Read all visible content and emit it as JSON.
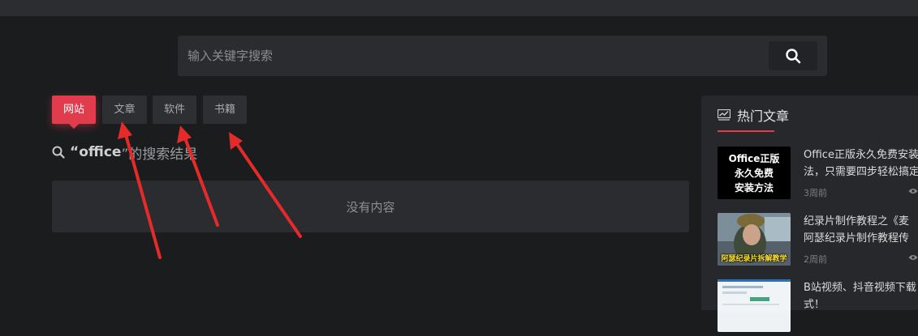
{
  "search": {
    "placeholder": "输入关键字搜索",
    "value": ""
  },
  "tabs": [
    {
      "label": "网站",
      "active": true
    },
    {
      "label": "文章",
      "active": false
    },
    {
      "label": "软件",
      "active": false
    },
    {
      "label": "书籍",
      "active": false
    }
  ],
  "results": {
    "prefix": "“",
    "query": "office",
    "suffix": "”的搜索结果",
    "empty_text": "没有内容"
  },
  "sidebar": {
    "title": "热门文章",
    "posts": [
      {
        "title_line1": "Office正版永久免费安装",
        "title_line2": "法，只需要四步轻松搞定",
        "time": "3周前",
        "thumb_lines": [
          "Office正版",
          "永久免费",
          "安装方法"
        ]
      },
      {
        "title_line1": "纪录片制作教程之《麦",
        "title_line2": "阿瑟纪录片制作教程传",
        "time": "2周前",
        "thumb_caption": "阿瑟纪录片拆解教学"
      },
      {
        "title_line1": "B站视频、抖音视频下载",
        "title_line2": "式！",
        "time": ""
      }
    ]
  },
  "colors": {
    "accent": "#e03c4c",
    "background": "#1b1c1e",
    "panel": "#2b2c2f",
    "arrow": "#e52a2a"
  },
  "icons": {
    "search": "search-icon",
    "result_search": "magnifier-icon",
    "hot": "trending-chart-icon",
    "views": "eye-icon"
  }
}
